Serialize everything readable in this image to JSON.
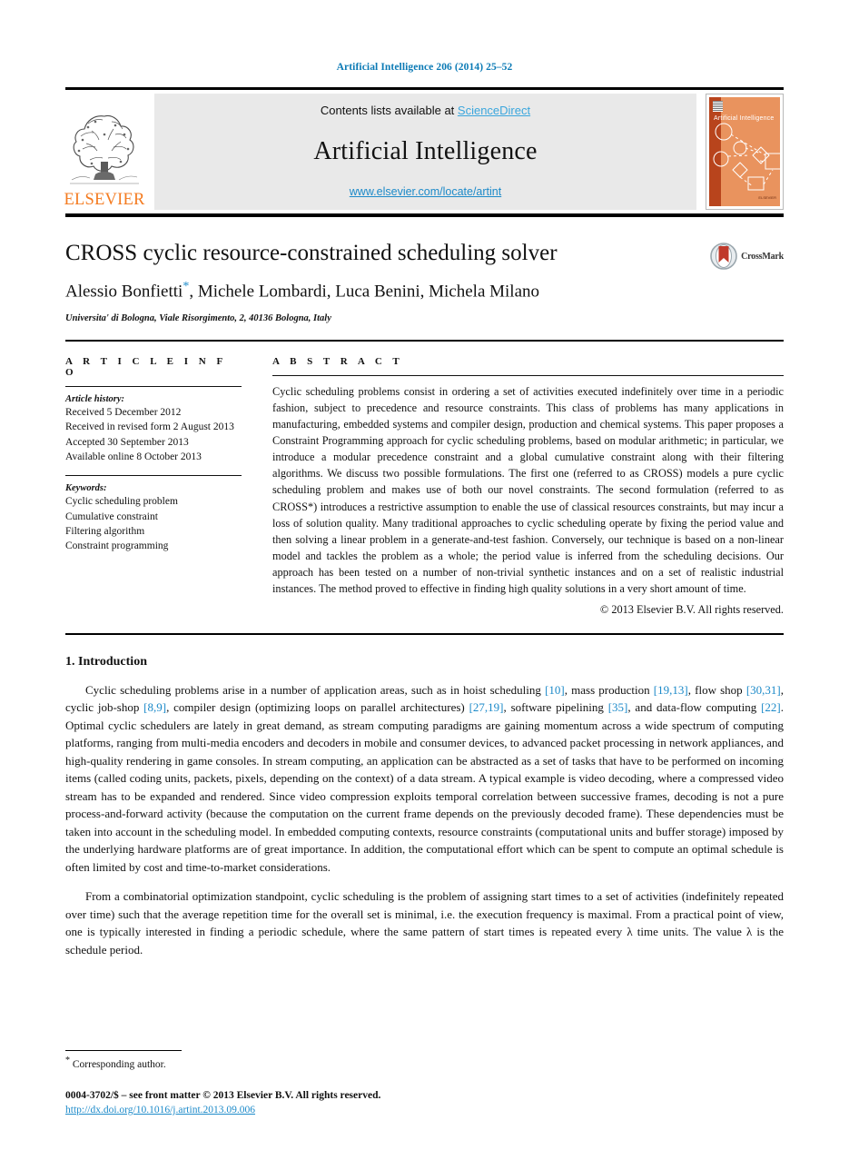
{
  "running_head": "Artificial Intelligence 206 (2014) 25–52",
  "masthead": {
    "publisher_name": "ELSEVIER",
    "contents_prefix": "Contents lists available at ",
    "contents_link": "ScienceDirect",
    "journal_name": "Artificial Intelligence",
    "journal_url": "www.elsevier.com/locate/artint",
    "cover_title": "Artificial Intelligence",
    "cover_footer": "ELSEVIER"
  },
  "title": "CROSS cyclic resource-constrained scheduling solver",
  "authors": "Alessio Bonfietti",
  "authors_rest": ", Michele Lombardi, Luca Benini, Michela Milano",
  "corresponding_marker": "*",
  "affiliation": "Universita' di Bologna, Viale Risorgimento, 2, 40136 Bologna, Italy",
  "crossmark_label": "CrossMark",
  "article_info": {
    "heading": "A R T I C L E   I N F O",
    "history_label": "Article history:",
    "history": [
      "Received 5 December 2012",
      "Received in revised form 2 August 2013",
      "Accepted 30 September 2013",
      "Available online 8 October 2013"
    ],
    "keywords_label": "Keywords:",
    "keywords": [
      "Cyclic scheduling problem",
      "Cumulative constraint",
      "Filtering algorithm",
      "Constraint programming"
    ]
  },
  "abstract": {
    "heading": "A B S T R A C T",
    "text": "Cyclic scheduling problems consist in ordering a set of activities executed indefinitely over time in a periodic fashion, subject to precedence and resource constraints. This class of problems has many applications in manufacturing, embedded systems and compiler design, production and chemical systems. This paper proposes a Constraint Programming approach for cyclic scheduling problems, based on modular arithmetic; in particular, we introduce a modular precedence constraint and a global cumulative constraint along with their filtering algorithms. We discuss two possible formulations. The first one (referred to as CROSS) models a pure cyclic scheduling problem and makes use of both our novel constraints. The second formulation (referred to as CROSS*) introduces a restrictive assumption to enable the use of classical resources constraints, but may incur a loss of solution quality. Many traditional approaches to cyclic scheduling operate by fixing the period value and then solving a linear problem in a generate-and-test fashion. Conversely, our technique is based on a non-linear model and tackles the problem as a whole; the period value is inferred from the scheduling decisions. Our approach has been tested on a number of non-trivial synthetic instances and on a set of realistic industrial instances. The method proved to effective in finding high quality solutions in a very short amount of time.",
    "copyright": "© 2013 Elsevier B.V. All rights reserved."
  },
  "section": {
    "number_title": "1. Introduction",
    "paragraph_1_parts": [
      "Cyclic scheduling problems arise in a number of application areas, such as in hoist scheduling ",
      "[10]",
      ", mass production ",
      "[19,13]",
      ", flow shop ",
      "[30,31]",
      ", cyclic job-shop ",
      "[8,9]",
      ", compiler design (optimizing loops on parallel architectures) ",
      "[27,19]",
      ", software pipelining ",
      "[35]",
      ", and data-flow computing ",
      "[22]",
      ". Optimal cyclic schedulers are lately in great demand, as stream computing paradigms are gaining momentum across a wide spectrum of computing platforms, ranging from multi-media encoders and decoders in mobile and consumer devices, to advanced packet processing in network appliances, and high-quality rendering in game consoles. In stream computing, an application can be abstracted as a set of tasks that have to be performed on incoming items (called coding units, packets, pixels, depending on the context) of a data stream. A typical example is video decoding, where a compressed video stream has to be expanded and rendered. Since video compression exploits temporal correlation between successive frames, decoding is not a pure process-and-forward activity (because the computation on the current frame depends on the previously decoded frame). These dependencies must be taken into account in the scheduling model. In embedded computing contexts, resource constraints (computational units and buffer storage) imposed by the underlying hardware platforms are of great importance. In addition, the computational effort which can be spent to compute an optimal schedule is often limited by cost and time-to-market considerations."
    ],
    "paragraph_2": "From a combinatorial optimization standpoint, cyclic scheduling is the problem of assigning start times to a set of activities (indefinitely repeated over time) such that the average repetition time for the overall set is minimal, i.e. the execution frequency is maximal. From a practical point of view, one is typically interested in finding a periodic schedule, where the same pattern of start times is repeated every λ time units. The value λ is the schedule period."
  },
  "footer": {
    "corresponding_star": "*",
    "corresponding_text": "Corresponding author.",
    "front_matter": "0004-3702/$ – see front matter © 2013 Elsevier B.V. All rights reserved.",
    "doi": "http://dx.doi.org/10.1016/j.artint.2013.09.006"
  },
  "colors": {
    "link_blue": "#1c8ac9",
    "running_head_blue": "#0b7ab5",
    "elsevier_orange": "#f47b20",
    "cover_orange": "#e9935e",
    "cover_spine": "#b8441c"
  }
}
